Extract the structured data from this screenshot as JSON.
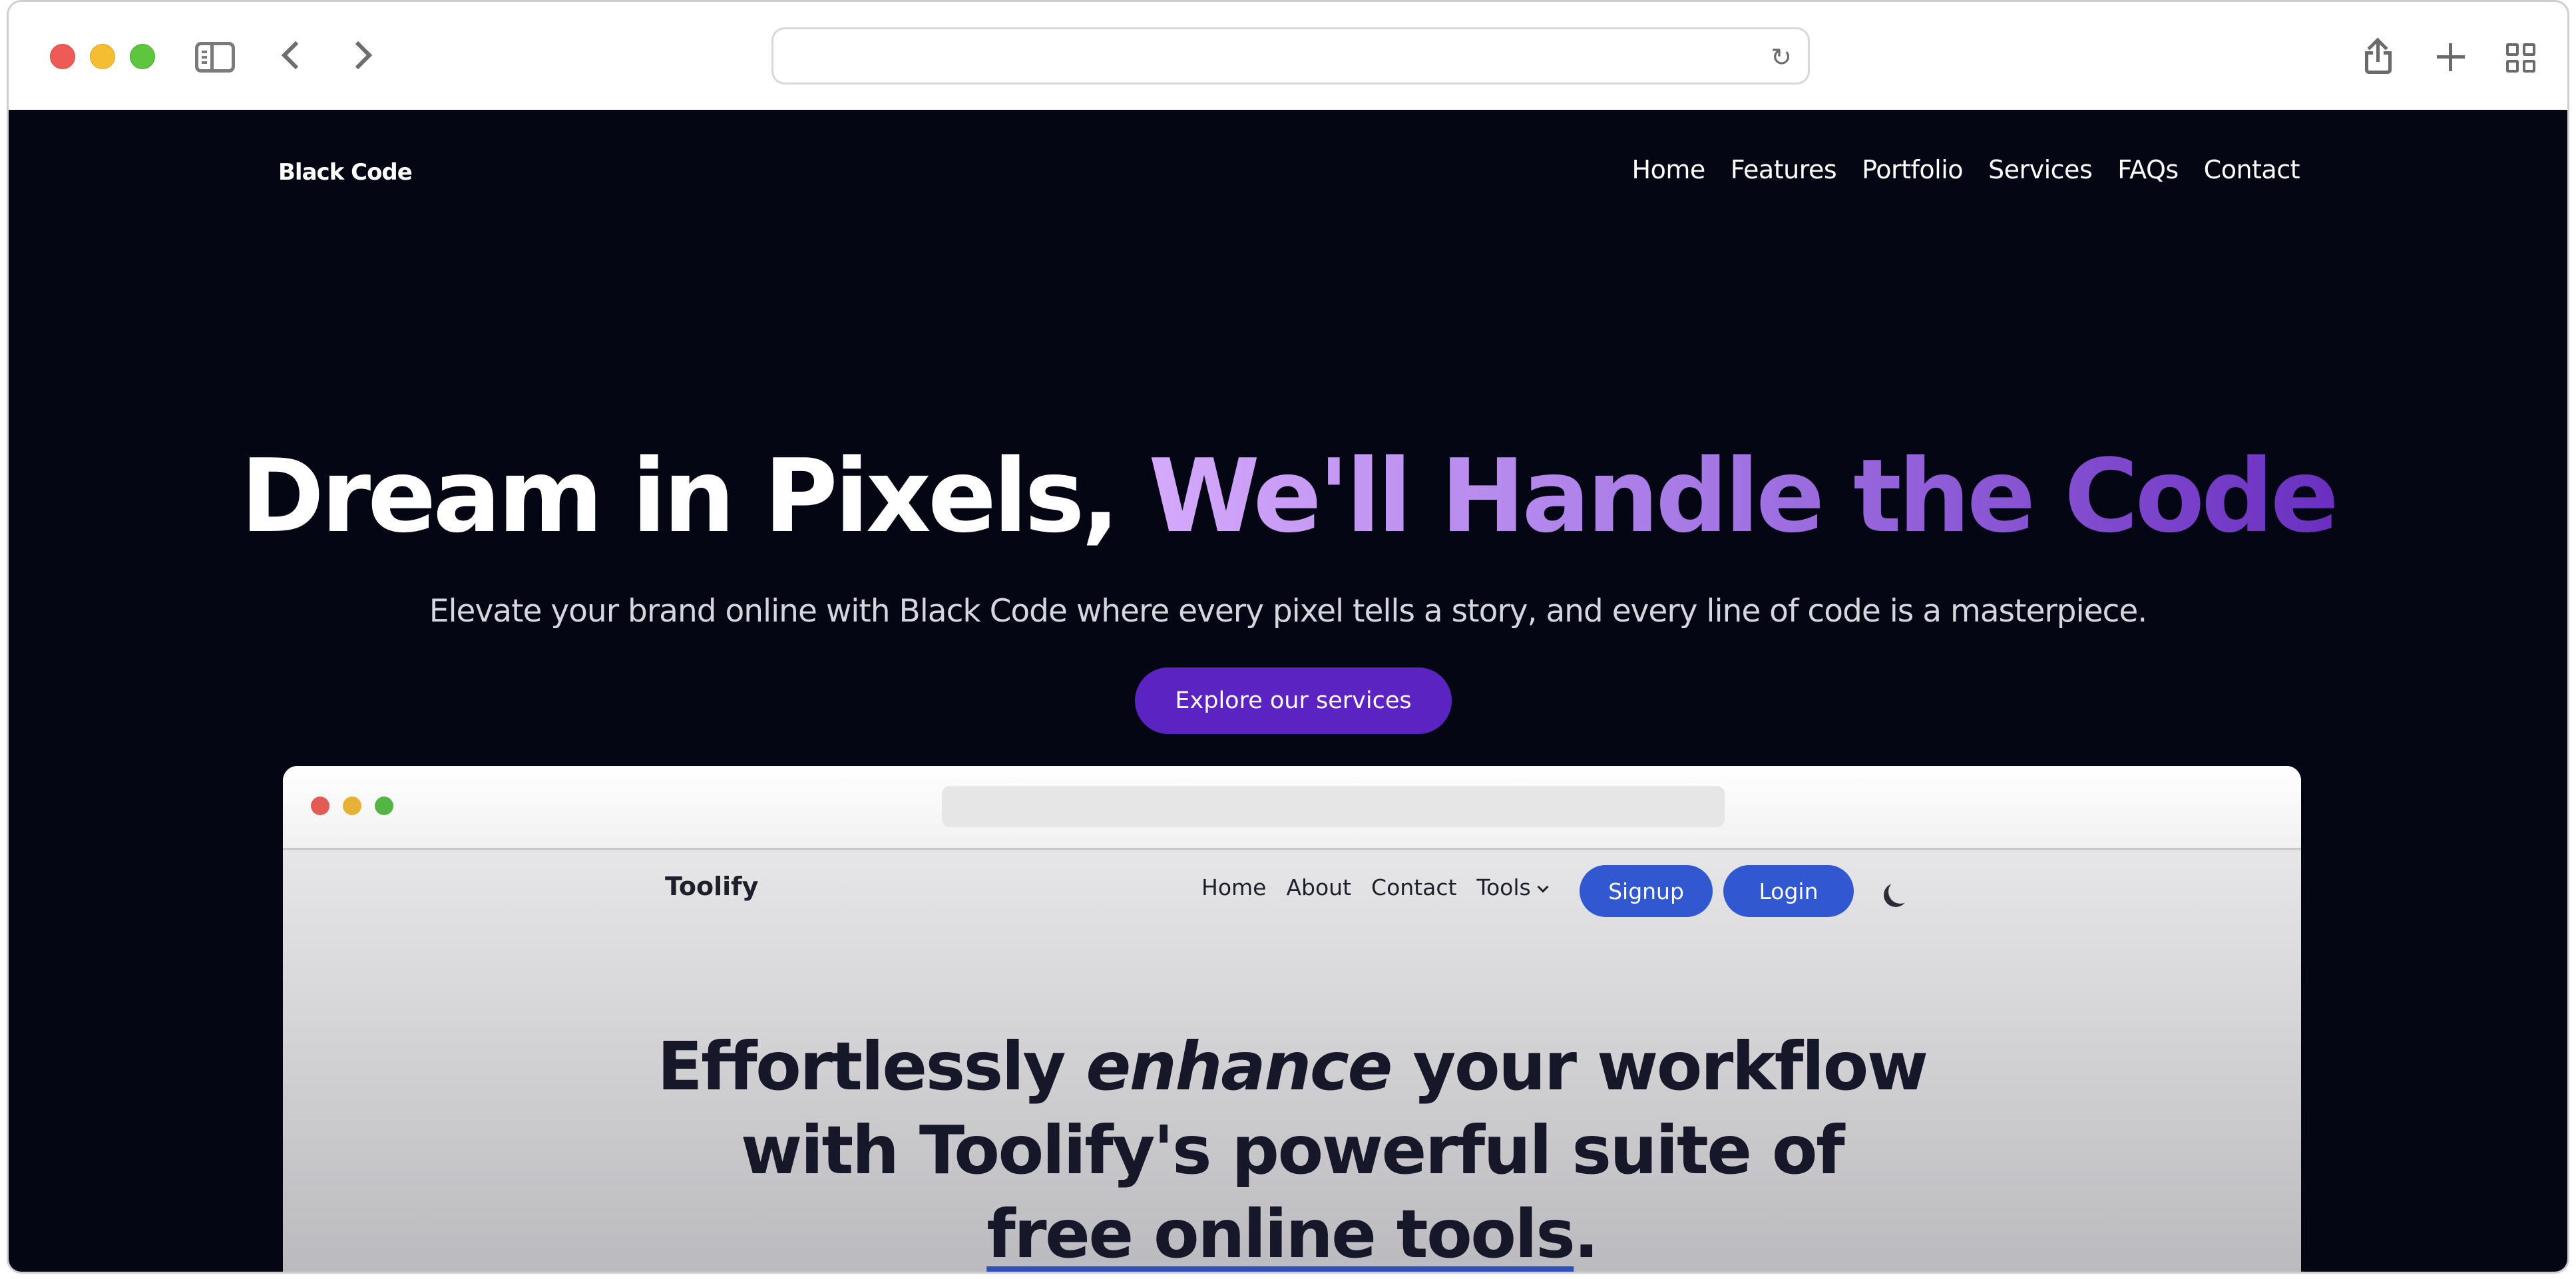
{
  "browser": {
    "address_placeholder": "",
    "icons": [
      "sidebar-icon",
      "back-icon",
      "forward-icon",
      "reload-icon",
      "share-icon",
      "new-tab-icon",
      "tab-overview-icon"
    ]
  },
  "site": {
    "logo": "Black Code",
    "nav": [
      "Home",
      "Features",
      "Portfolio",
      "Services",
      "FAQs",
      "Contact"
    ],
    "hero": {
      "title_white": "Dream in Pixels,",
      "title_gradient": "We'll Handle the Code",
      "subtitle": "Elevate your brand online with Black Code where every pixel tells a story, and every line of code is a masterpiece.",
      "cta": "Explore our services"
    },
    "colors": {
      "background": "#050614",
      "accent": "#5b24c2",
      "gradient_start": "#d5a9fb",
      "gradient_end": "#6a2fc0"
    }
  },
  "mock": {
    "logo": "Toolify",
    "nav": [
      "Home",
      "About",
      "Contact",
      "Tools"
    ],
    "signup": "Signup",
    "login": "Login",
    "headline": {
      "part1": "Effortlessly ",
      "italic": "enhance",
      "part2": " your workflow",
      "line2": "with Toolify's powerful suite of",
      "underlined": "free online tools",
      "end": "."
    },
    "colors": {
      "button": "#3158d0"
    }
  }
}
